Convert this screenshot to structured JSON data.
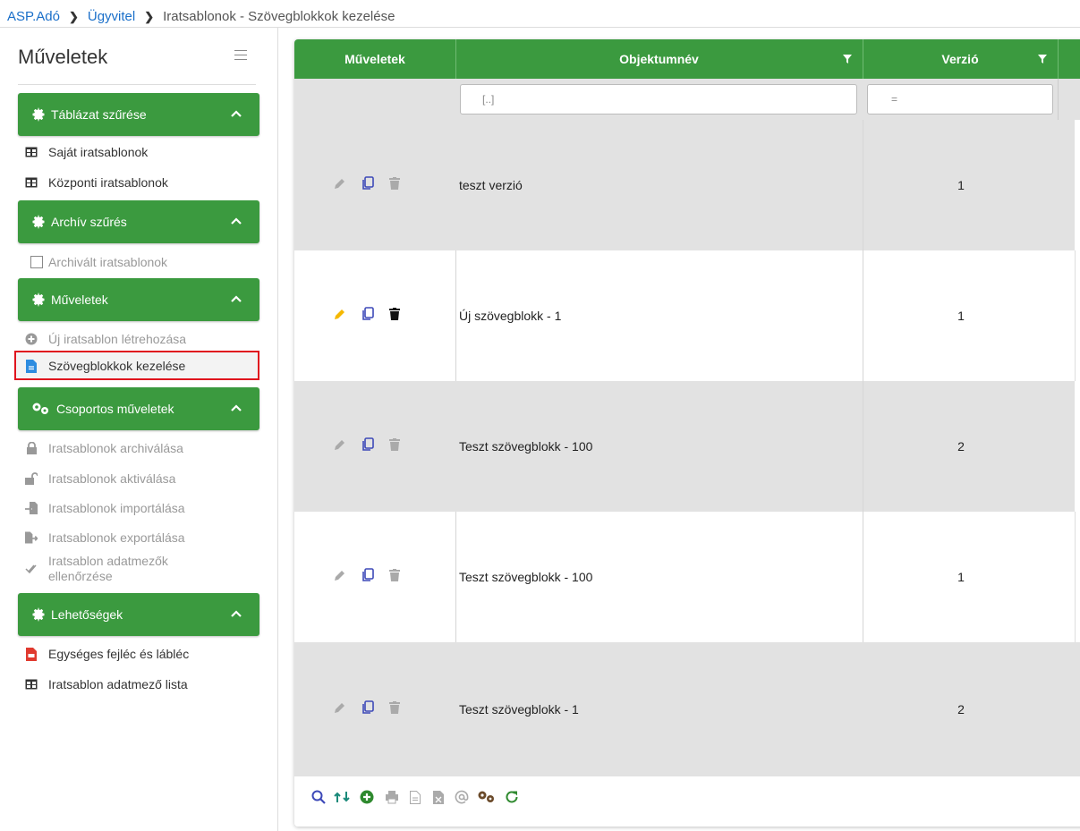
{
  "breadcrumb": {
    "items": [
      "ASP.Adó",
      "Ügyvitel",
      "Iratsablonok - Szövegblokkok kezelése"
    ]
  },
  "sidebar": {
    "title": "Műveletek",
    "sections": [
      {
        "label": "Táblázat szűrése",
        "items": [
          {
            "label": "Saját iratsablonok",
            "icon": "table-icon"
          },
          {
            "label": "Központi iratsablonok",
            "icon": "table-icon"
          }
        ]
      },
      {
        "label": "Archív szűrés",
        "items": [
          {
            "label": "Archivált iratsablonok",
            "icon": "checkbox-icon"
          }
        ]
      },
      {
        "label": "Műveletek",
        "items": [
          {
            "label": "Új iratsablon létrehozása",
            "icon": "add-circle-icon"
          },
          {
            "label": "Szövegblokkok kezelése",
            "icon": "document-icon"
          }
        ]
      },
      {
        "label": "Csoportos műveletek",
        "items": [
          {
            "label": "Iratsablonok archiválása",
            "icon": "lock-icon"
          },
          {
            "label": "Iratsablonok aktiválása",
            "icon": "unlock-icon"
          },
          {
            "label": "Iratsablonok importálása",
            "icon": "import-icon"
          },
          {
            "label": "Iratsablonok exportálása",
            "icon": "export-icon"
          },
          {
            "label": "Iratsablon adatmezők",
            "label2": "ellenőrzése",
            "icon": "double-check-icon"
          }
        ]
      },
      {
        "label": "Lehetőségek",
        "items": [
          {
            "label": "Egységes fejléc és lábléc",
            "icon": "pdf-icon"
          },
          {
            "label": "Iratsablon adatmező lista",
            "icon": "table-icon"
          }
        ]
      }
    ]
  },
  "table": {
    "columns": [
      "Műveletek",
      "Objektumnév",
      "Verzió"
    ],
    "filters": {
      "name_placeholder": "[..]",
      "version_placeholder": "="
    },
    "rows": [
      {
        "name": "teszt verzió",
        "version": "1"
      },
      {
        "name": "Új szövegblokk - 1",
        "version": "1"
      },
      {
        "name": "Teszt szövegblokk - 100",
        "version": "2"
      },
      {
        "name": "Teszt szövegblokk - 100",
        "version": "1"
      },
      {
        "name": "Teszt szövegblokk - 1",
        "version": "2"
      }
    ]
  },
  "toolbar": {
    "icons": [
      "search-icon",
      "swap-icon",
      "add-icon",
      "print-icon",
      "doc-icon",
      "excel-icon",
      "email-icon",
      "settings-icon",
      "refresh-icon"
    ]
  },
  "colors": {
    "accent_green": "#3b9a3f",
    "highlight_red": "#e0141e",
    "link_blue": "#1a6fc9"
  }
}
